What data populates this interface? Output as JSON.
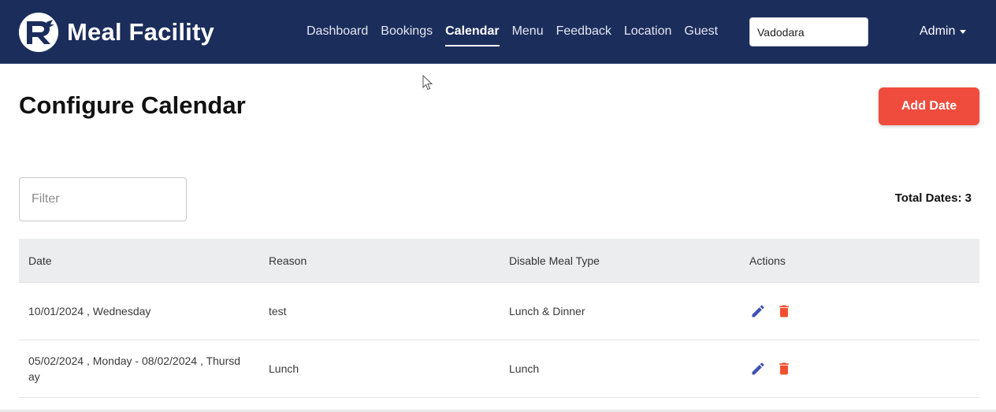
{
  "header": {
    "brand": "Meal Facility",
    "brand_logo_icon": "brand-r-logo-icon",
    "nav": [
      {
        "label": "Dashboard",
        "active": false
      },
      {
        "label": "Bookings",
        "active": false
      },
      {
        "label": "Calendar",
        "active": true
      },
      {
        "label": "Menu",
        "active": false
      },
      {
        "label": "Feedback",
        "active": false
      },
      {
        "label": "Location",
        "active": false
      },
      {
        "label": "Guest",
        "active": false
      }
    ],
    "location_value": "Vadodara",
    "user_menu": "Admin",
    "background_color": "#1b2d5b"
  },
  "page": {
    "title": "Configure Calendar",
    "add_button": "Add Date",
    "add_button_color": "#ef4c3d",
    "filter_placeholder": "Filter",
    "filter_value": "",
    "total_label": "Total Dates: 3"
  },
  "table": {
    "columns": [
      "Date",
      "Reason",
      "Disable Meal Type",
      "Actions"
    ],
    "rows": [
      {
        "date": "10/01/2024 , Wednesday",
        "reason": "test",
        "meal_type": "Lunch & Dinner",
        "actions": [
          "edit-icon",
          "delete-icon"
        ]
      },
      {
        "date": "05/02/2024 , Monday - 08/02/2024 , Thursday",
        "reason": "Lunch",
        "meal_type": "Lunch",
        "actions": [
          "edit-icon",
          "delete-icon"
        ]
      }
    ],
    "edit_color": "#3f51b5",
    "delete_color": "#f0502f"
  }
}
